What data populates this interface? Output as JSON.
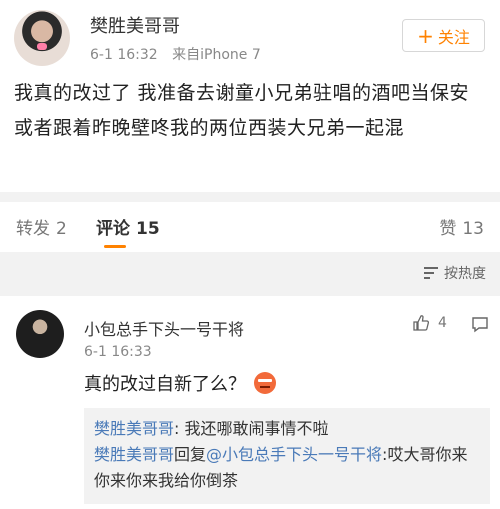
{
  "post": {
    "author": "樊胜美哥哥",
    "time": "6-1 16:32",
    "source": "来自iPhone 7",
    "follow_label": "关注",
    "follow_color": "#ff8200",
    "content": "我真的改过了 我准备去谢童小兄弟驻唱的酒吧当保安 或者跟着昨晚壁咚我的两位西装大兄弟一起混"
  },
  "tabs": {
    "repost_label": "转发",
    "repost_count": "2",
    "comment_label": "评论",
    "comment_count": "15",
    "like_label": "赞",
    "like_count": "13"
  },
  "sort": {
    "label": "按热度"
  },
  "comment": {
    "author": "小包总手下头一号干将",
    "time": "6-1 16:33",
    "text": "真的改过自新了么？",
    "like_count": "4",
    "replies": [
      {
        "name": "樊胜美哥哥",
        "text": ": 我还哪敢闹事情不啦"
      },
      {
        "name": "樊胜美哥哥",
        "text": "回复",
        "mention": "@小包总手下头一号干将",
        "text2": ":哎大哥你来你来你来我给你倒茶"
      }
    ]
  }
}
